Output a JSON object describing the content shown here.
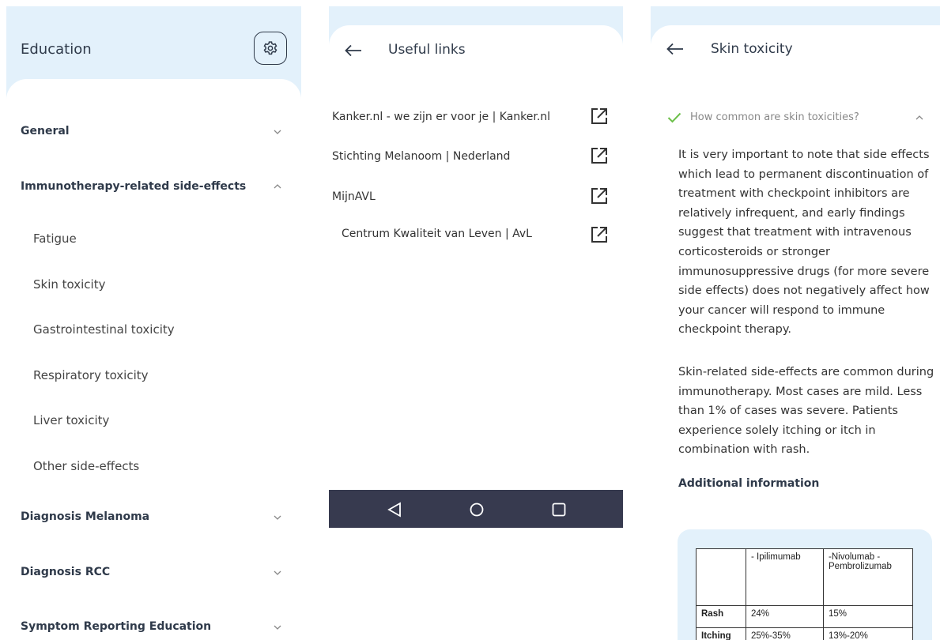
{
  "education": {
    "title": "Education",
    "sections": [
      {
        "label": "General",
        "expanded": false
      },
      {
        "label": "Immunotherapy-related side-effects",
        "expanded": true,
        "items": [
          "Fatigue",
          "Skin toxicity",
          "Gastrointestinal toxicity",
          "Respiratory toxicity",
          "Liver toxicity",
          "Other side-effects"
        ]
      },
      {
        "label": "Diagnosis Melanoma",
        "expanded": false
      },
      {
        "label": "Diagnosis RCC",
        "expanded": false
      },
      {
        "label": "Symptom Reporting Education",
        "expanded": false
      }
    ],
    "icons": {
      "settings": "gear-icon",
      "collapsed": "chevron-down-icon",
      "expanded": "chevron-up-icon"
    }
  },
  "useful_links": {
    "title": "Useful links",
    "links": [
      "Kanker.nl - we zijn er voor je | Kanker.nl",
      "Stichting Melanoom | Nederland",
      "MijnAVL",
      "Centrum Kwaliteit van Leven | AvL"
    ],
    "icons": {
      "back": "arrow-left-icon",
      "external": "external-link-icon"
    },
    "navbar": {
      "back": "triangle-back-icon",
      "home": "circle-home-icon",
      "recents": "square-recents-icon"
    }
  },
  "skin_toxicity": {
    "title": "Skin toxicity",
    "question": "How common are skin toxicities?",
    "paragraph1": "It is very important to note that side effects which lead to permanent discontinuation of treatment with checkpoint inhibitors are relatively infrequent, and early findings suggest that treatment with intravenous corticosteroids or stronger immunosuppressive drugs (for more severe side effects) does not negatively affect how your cancer will respond to immune checkpoint therapy.",
    "paragraph2": "Skin-related side-effects are common during immunotherapy. Most cases are mild. Less than 1% of cases was severe. Patients experience solely itching or itch in combination with rash.",
    "additional": "Additional information",
    "table": {
      "headers": [
        "",
        "- Ipilimumab",
        "-Nivolumab -Pembrolizumab"
      ],
      "rows": [
        [
          "Rash",
          "24%",
          "15%"
        ],
        [
          "Itching",
          "25%-35%",
          "13%-20%"
        ]
      ]
    }
  },
  "colors": {
    "panel_bg": "#e3f1fb",
    "navbar": "#373a4f",
    "check": "#6cc04a",
    "text_dark": "#2f3a4a"
  }
}
